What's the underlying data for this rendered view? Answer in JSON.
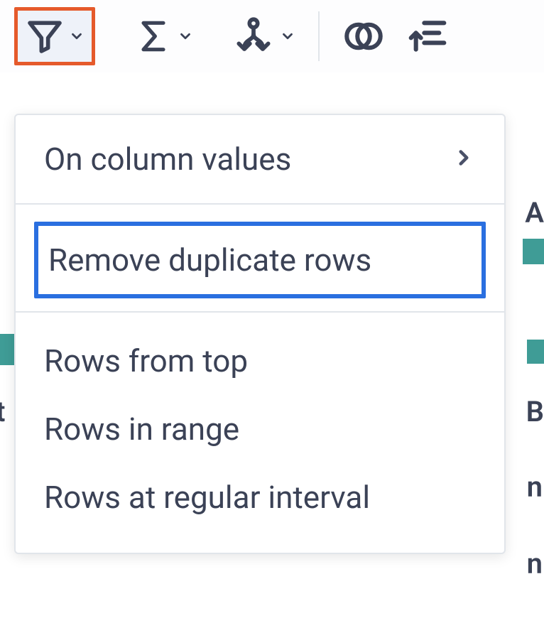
{
  "toolbar": {
    "filter": {
      "name": "filter-icon"
    },
    "sigma": {
      "name": "sigma-icon"
    },
    "split": {
      "name": "split-icon"
    },
    "overlap": {
      "name": "overlap-icon"
    },
    "sort": {
      "name": "sort-icon"
    }
  },
  "menu": {
    "on_column_values": "On column values",
    "remove_duplicate_rows": "Remove duplicate rows",
    "rows_from_top": "Rows from top",
    "rows_in_range": "Rows in range",
    "rows_at_regular_interval": "Rows at regular interval"
  },
  "background": {
    "letter_A": "A",
    "letter_t": "t",
    "letter_B": "B",
    "letter_n1": "n",
    "letter_n2": "n"
  }
}
